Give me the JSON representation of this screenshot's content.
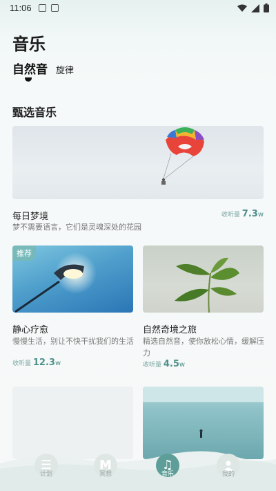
{
  "status_bar": {
    "time": "11:06"
  },
  "page": {
    "title": "音乐"
  },
  "tabs": [
    {
      "label": "自然音",
      "active": true
    },
    {
      "label": "旋律",
      "active": false
    }
  ],
  "section": {
    "title": "甄选音乐"
  },
  "featured": {
    "title": "每日梦境",
    "description": "梦不需要语言，它们是灵魂深处的花园",
    "listen_label": "收听量",
    "listen_value": "7.3",
    "listen_unit": "w"
  },
  "cards": [
    {
      "badge": "推荐",
      "title": "静心疗愈",
      "description": "慢慢生活，别让不快干扰我们的生活",
      "listen_label": "收听量",
      "listen_value": "12.3",
      "listen_unit": "w"
    },
    {
      "title": "自然奇境之旅",
      "description": "精选自然音，使你放松心情，缓解压力",
      "listen_label": "收听量",
      "listen_value": "4.5",
      "listen_unit": "w"
    }
  ],
  "bottom_nav": [
    {
      "label": "计划",
      "icon": "list-icon",
      "active": false
    },
    {
      "label": "冥想",
      "icon": "m-letter-icon",
      "active": false
    },
    {
      "label": "音乐",
      "icon": "music-note-icon",
      "active": true
    },
    {
      "label": "我的",
      "icon": "user-icon",
      "active": false
    }
  ],
  "colors": {
    "accent": "#5e9e98",
    "listen_number": "#4e8f8a",
    "background": "#f6f9f9"
  }
}
